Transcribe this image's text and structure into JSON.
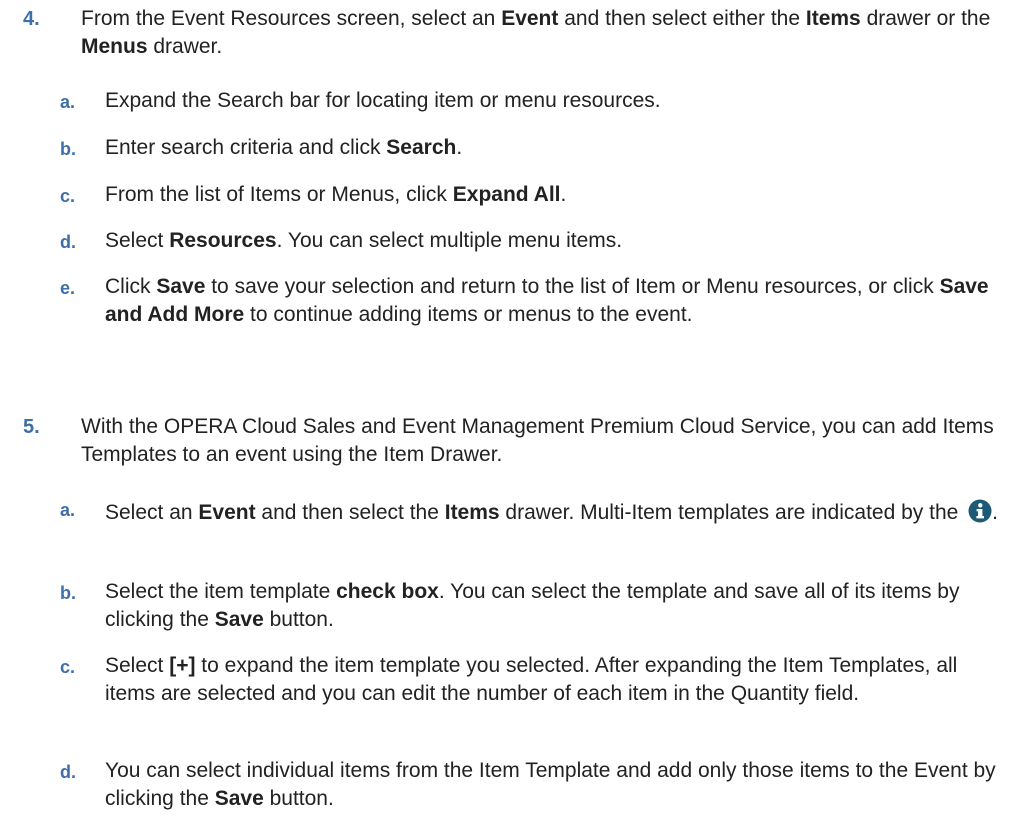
{
  "steps": [
    {
      "number": "4.",
      "segments": [
        {
          "t": "From the Event Resources screen, select an "
        },
        {
          "t": "Event",
          "b": true
        },
        {
          "t": " and then select either the "
        },
        {
          "t": "Items",
          "b": true
        },
        {
          "t": " drawer or the "
        },
        {
          "t": "Menus",
          "b": true
        },
        {
          "t": " drawer."
        }
      ],
      "substeps": [
        {
          "letter": "a.",
          "segments": [
            {
              "t": "Expand the Search bar for locating item or menu resources."
            }
          ]
        },
        {
          "letter": "b.",
          "segments": [
            {
              "t": "Enter search criteria and click "
            },
            {
              "t": "Search",
              "b": true
            },
            {
              "t": "."
            }
          ]
        },
        {
          "letter": "c.",
          "segments": [
            {
              "t": "From the list of Items or Menus, click "
            },
            {
              "t": "Expand All",
              "b": true
            },
            {
              "t": "."
            }
          ]
        },
        {
          "letter": "d.",
          "segments": [
            {
              "t": "Select "
            },
            {
              "t": "Resources",
              "b": true
            },
            {
              "t": ". You can select multiple menu items."
            }
          ]
        },
        {
          "letter": "e.",
          "segments": [
            {
              "t": "Click "
            },
            {
              "t": "Save",
              "b": true
            },
            {
              "t": " to save your selection and return to the list of Item or Menu resources, or click "
            },
            {
              "t": "Save and Add More",
              "b": true
            },
            {
              "t": " to continue adding items or menus to the event."
            }
          ]
        }
      ]
    },
    {
      "number": "5.",
      "segments": [
        {
          "t": "With the OPERA Cloud Sales and Event Management Premium Cloud Service, you can add Items Templates to an event using the Item Drawer."
        }
      ],
      "substeps": [
        {
          "letter": "a.",
          "segments": [
            {
              "t": "Select an "
            },
            {
              "t": "Event",
              "b": true
            },
            {
              "t": " and then select the "
            },
            {
              "t": "Items",
              "b": true
            },
            {
              "t": " drawer. Multi-Item templates are indicated by the "
            },
            {
              "icon": "info-icon"
            },
            {
              "t": "."
            }
          ]
        },
        {
          "letter": "b.",
          "segments": [
            {
              "t": "Select the item template "
            },
            {
              "t": "check box",
              "b": true
            },
            {
              "t": ". You can select the template and save all of its items by clicking the "
            },
            {
              "t": "Save",
              "b": true
            },
            {
              "t": " button."
            }
          ]
        },
        {
          "letter": "c.",
          "segments": [
            {
              "t": "Select "
            },
            {
              "t": "[+]",
              "b": true
            },
            {
              "t": " to expand the item template you selected. After expanding the Item Templates, all items are selected and you can edit the number of each item in the Quantity field."
            }
          ]
        },
        {
          "letter": "d.",
          "segments": [
            {
              "t": "You can select individual items from the Item Template and add only those items to the Event by clicking the "
            },
            {
              "t": "Save",
              "b": true
            },
            {
              "t": " button."
            }
          ]
        }
      ]
    }
  ],
  "colors": {
    "marker": "#3f6fa8",
    "text": "#222222",
    "icon": "#1e5a76"
  }
}
